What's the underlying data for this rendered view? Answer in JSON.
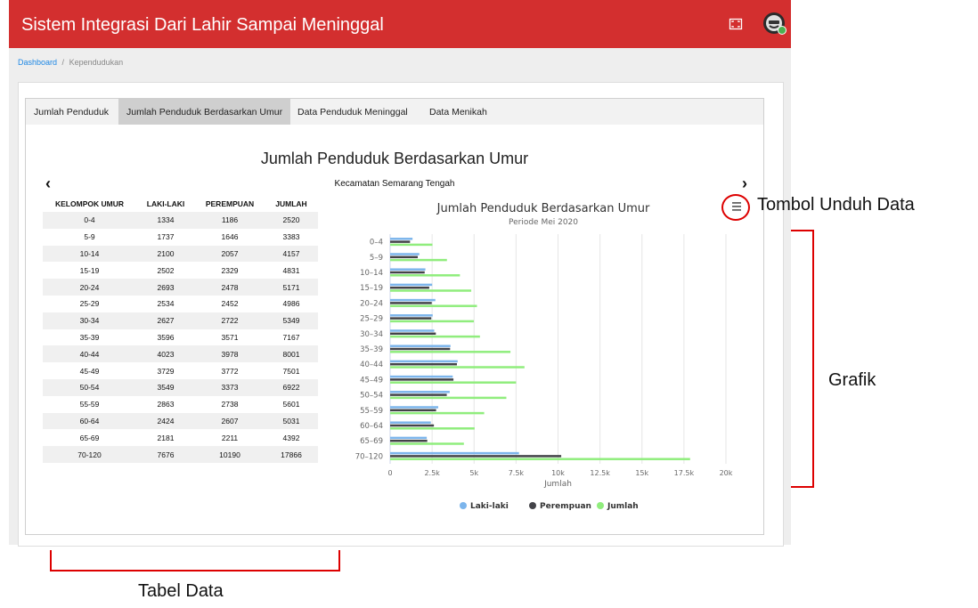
{
  "header": {
    "title": "Sistem Integrasi Dari Lahir Sampai Meninggal",
    "expand_icon": "fullscreen-icon",
    "avatar_icon": "user-avatar-icon",
    "accent": "#d32f2f"
  },
  "breadcrumb": {
    "home": "Dashboard",
    "separator": "/",
    "current": "Kependudukan"
  },
  "tabs": [
    {
      "label": "Jumlah Penduduk",
      "active": false
    },
    {
      "label": "Jumlah Penduduk Berdasarkan Umur",
      "active": true
    },
    {
      "label": "Data Penduduk Meninggal",
      "active": false
    },
    {
      "label": "Data Menikah",
      "active": false
    }
  ],
  "panel": {
    "title": "Jumlah Penduduk Berdasarkan Umur",
    "kecamatan": "Kecamatan Semarang Tengah",
    "prev_arrow": "‹",
    "next_arrow": "›"
  },
  "table": {
    "headers": [
      "KELOMPOK UMUR",
      "LAKI-LAKI",
      "PEREMPUAN",
      "JUMLAH"
    ],
    "rows": [
      [
        "0-4",
        "1334",
        "1186",
        "2520"
      ],
      [
        "5-9",
        "1737",
        "1646",
        "3383"
      ],
      [
        "10-14",
        "2100",
        "2057",
        "4157"
      ],
      [
        "15-19",
        "2502",
        "2329",
        "4831"
      ],
      [
        "20-24",
        "2693",
        "2478",
        "5171"
      ],
      [
        "25-29",
        "2534",
        "2452",
        "4986"
      ],
      [
        "30-34",
        "2627",
        "2722",
        "5349"
      ],
      [
        "35-39",
        "3596",
        "3571",
        "7167"
      ],
      [
        "40-44",
        "4023",
        "3978",
        "8001"
      ],
      [
        "45-49",
        "3729",
        "3772",
        "7501"
      ],
      [
        "50-54",
        "3549",
        "3373",
        "6922"
      ],
      [
        "55-59",
        "2863",
        "2738",
        "5601"
      ],
      [
        "60-64",
        "2424",
        "2607",
        "5031"
      ],
      [
        "65-69",
        "2181",
        "2211",
        "4392"
      ],
      [
        "70-120",
        "7676",
        "10190",
        "17866"
      ]
    ]
  },
  "chart_data": {
    "type": "bar",
    "orientation": "horizontal",
    "title": "Jumlah Penduduk Berdasarkan Umur",
    "subtitle": "Periode Mei 2020",
    "xlabel": "Jumlah",
    "ylabel": "",
    "xlim": [
      0,
      20000
    ],
    "xticks": [
      0,
      2500,
      5000,
      7500,
      10000,
      12500,
      15000,
      17500,
      20000
    ],
    "xtick_labels": [
      "0",
      "2.5k",
      "5k",
      "7.5k",
      "10k",
      "12.5k",
      "15k",
      "17.5k",
      "20k"
    ],
    "grid": true,
    "legend": "bottom",
    "menu_icon": "hamburger-menu-icon",
    "categories": [
      "0–4",
      "5–9",
      "10–14",
      "15–19",
      "20–24",
      "25–29",
      "30–34",
      "35–39",
      "40–44",
      "45–49",
      "50–54",
      "55–59",
      "60–64",
      "65–69",
      "70–120"
    ],
    "series": [
      {
        "name": "Laki-laki",
        "color": "#7cb5ec",
        "values": [
          1334,
          1737,
          2100,
          2502,
          2693,
          2534,
          2627,
          3596,
          4023,
          3729,
          3549,
          2863,
          2424,
          2181,
          7676
        ]
      },
      {
        "name": "Perempuan",
        "color": "#434348",
        "values": [
          1186,
          1646,
          2057,
          2329,
          2478,
          2452,
          2722,
          3571,
          3978,
          3772,
          3373,
          2738,
          2607,
          2211,
          10190
        ]
      },
      {
        "name": "Jumlah",
        "color": "#90ed7d",
        "values": [
          2520,
          3383,
          4157,
          4831,
          5171,
          4986,
          5349,
          7167,
          8001,
          7501,
          6922,
          5601,
          5031,
          4392,
          17866
        ]
      }
    ]
  },
  "annotations": {
    "download_button": "Tombol Unduh Data",
    "chart": "Grafik",
    "table": "Tabel Data",
    "color": "#dd0000"
  }
}
